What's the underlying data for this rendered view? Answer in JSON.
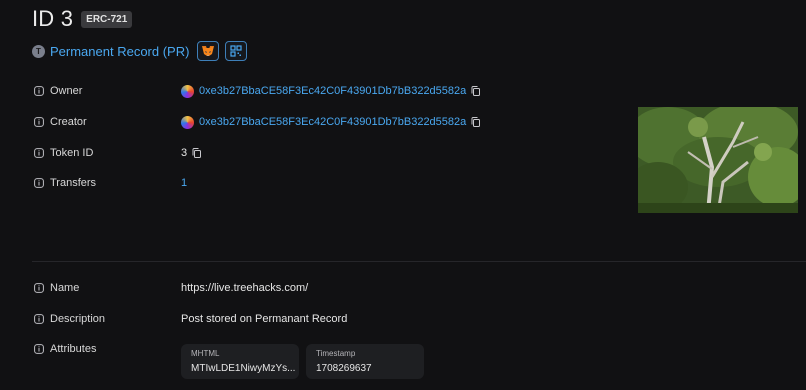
{
  "header": {
    "title": "ID 3",
    "badge": "ERC-721"
  },
  "collection": {
    "initial": "T",
    "name": "Permanent Record (PR)",
    "buttons": [
      "metamask-icon",
      "qr-code-icon"
    ]
  },
  "details": {
    "owner": {
      "label": "Owner",
      "address": "0xe3b27BbaCE58F3Ec42C0F43901Db7bB322d5582a"
    },
    "creator": {
      "label": "Creator",
      "address": "0xe3b27BbaCE58F3Ec42C0F43901Db7bB322d5582a"
    },
    "token_id": {
      "label": "Token ID",
      "value": "3"
    },
    "transfers": {
      "label": "Transfers",
      "value": "1"
    }
  },
  "metadata": {
    "name": {
      "label": "Name",
      "value": "https://live.treehacks.com/"
    },
    "description": {
      "label": "Description",
      "value": "Post stored on Permanant Record"
    },
    "attributes": {
      "label": "Attributes",
      "items": [
        {
          "key": "MHTML",
          "value": "MTIwLDE1NiwyMzYs..."
        },
        {
          "key": "Timestamp",
          "value": "1708269637"
        }
      ]
    }
  }
}
